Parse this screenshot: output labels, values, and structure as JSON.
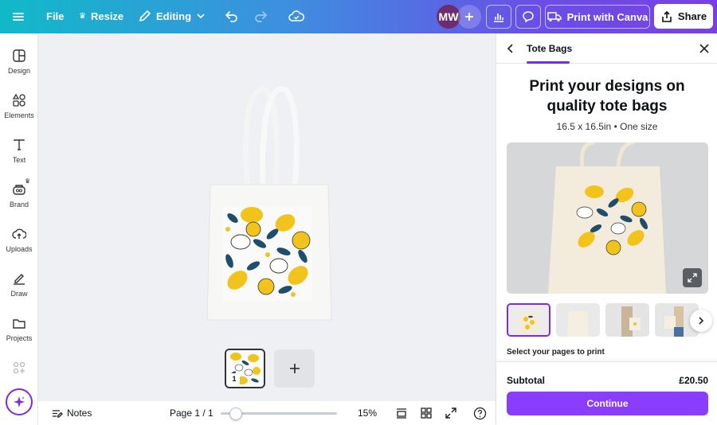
{
  "topbar": {
    "file_label": "File",
    "resize_label": "Resize",
    "editing_label": "Editing",
    "avatar_initials": "MW",
    "print_label": "Print with Canva",
    "share_label": "Share"
  },
  "sidebar": {
    "items": [
      {
        "label": "Design",
        "icon": "design-icon"
      },
      {
        "label": "Elements",
        "icon": "elements-icon"
      },
      {
        "label": "Text",
        "icon": "text-icon"
      },
      {
        "label": "Brand",
        "icon": "brand-icon"
      },
      {
        "label": "Uploads",
        "icon": "uploads-icon"
      },
      {
        "label": "Draw",
        "icon": "draw-icon"
      },
      {
        "label": "Projects",
        "icon": "projects-icon"
      }
    ]
  },
  "pages": {
    "thumb_number": "1"
  },
  "bottombar": {
    "notes_label": "Notes",
    "page_indicator": "Page 1 / 1",
    "zoom_label": "15%",
    "zoom_percent": 15
  },
  "panel": {
    "tab_label": "Tote Bags",
    "headline": "Print your designs on quality tote bags",
    "size_info": "16.5 x 16.5in • One size",
    "select_pages_label": "Select your pages to print",
    "subtotal_label": "Subtotal",
    "subtotal_price": "£20.50",
    "continue_label": "Continue"
  },
  "colors": {
    "accent": "#8b3dff",
    "topbar_start": "#11b9c8",
    "topbar_end": "#7a3fe4",
    "lemon": "#f2c31b",
    "leaf": "#1f4e6b"
  }
}
